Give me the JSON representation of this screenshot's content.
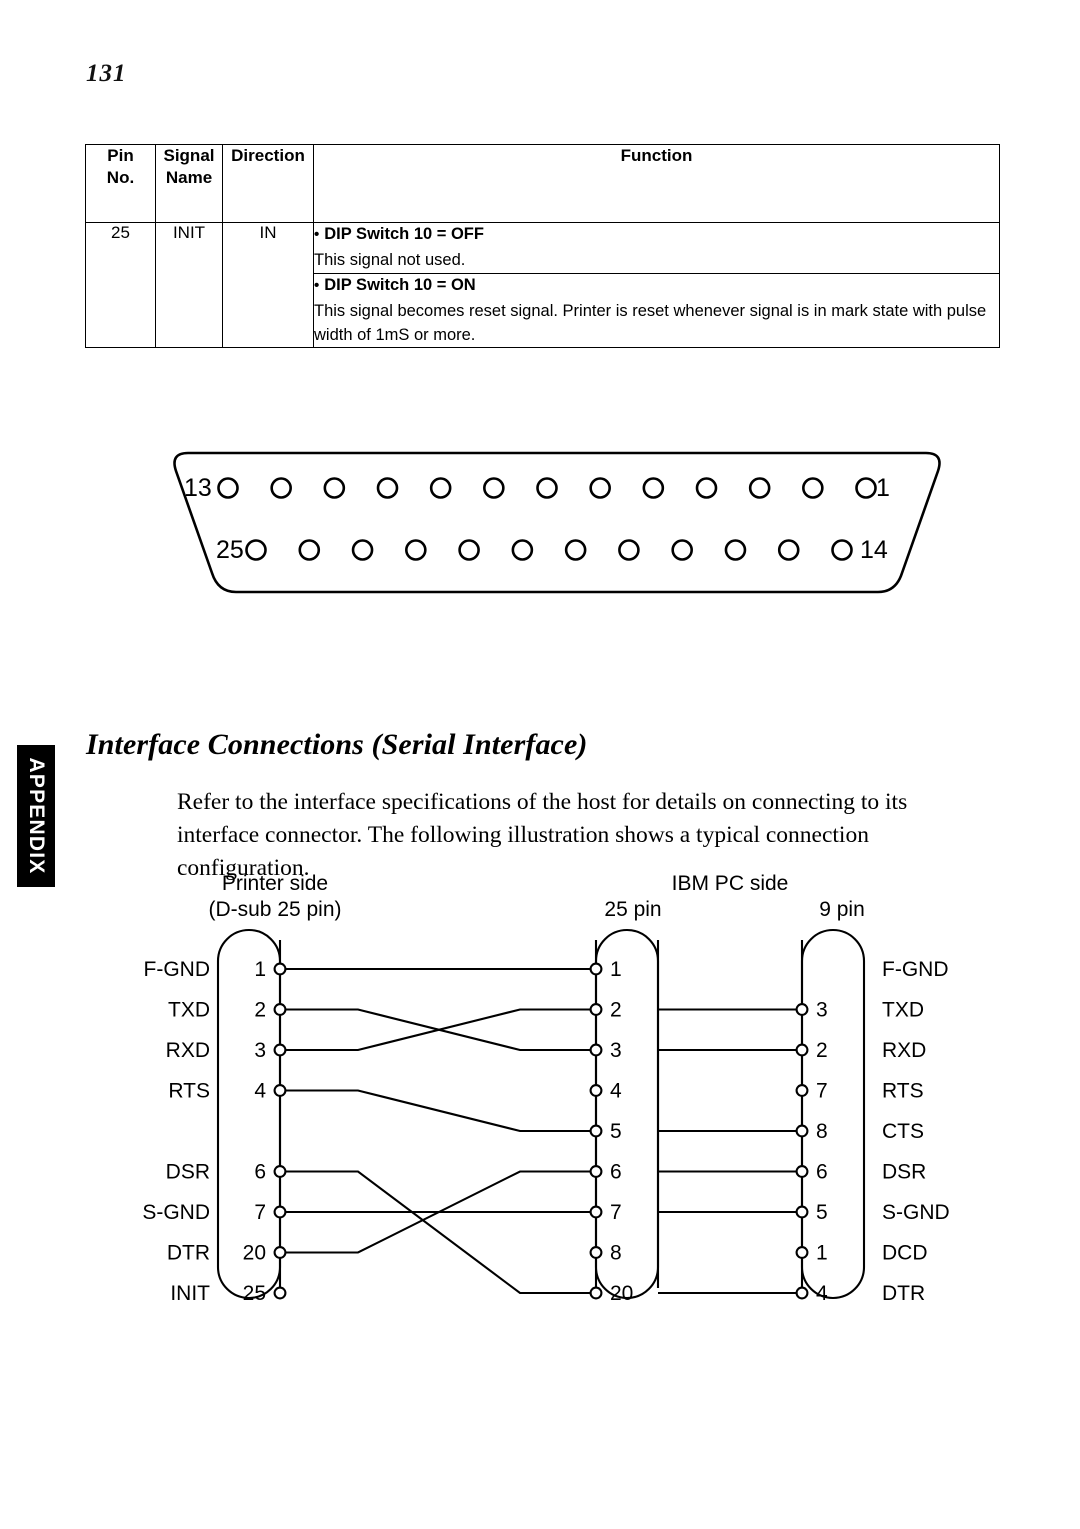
{
  "page": {
    "number": "131",
    "appendix_tab": "APPENDIX"
  },
  "pin_table": {
    "headers": {
      "pin_no": "Pin\nNo.",
      "pin_no_line1": "Pin",
      "pin_no_line2": "No.",
      "signal_name_line1": "Signal",
      "signal_name_line2": "Name",
      "direction": "Direction",
      "function": "Function"
    },
    "rows": [
      {
        "pin_no": "25",
        "signal_name": "INIT",
        "direction": "IN",
        "function_blocks": [
          {
            "bullet": "DIP Switch 10 = OFF",
            "body": "This signal not used."
          },
          {
            "bullet": "DIP Switch 10 = ON",
            "body": "This signal becomes reset signal. Printer is reset whenever signal is in mark state with pulse width of 1mS or more."
          }
        ]
      }
    ]
  },
  "dsub_connector": {
    "top_row_left_label": "13",
    "top_row_right_label": "1",
    "bottom_row_left_label": "25",
    "bottom_row_right_label": "14",
    "top_row_pin_count": 13,
    "bottom_row_pin_count": 12
  },
  "section": {
    "heading": "Interface Connections (Serial Interface)",
    "paragraph": "Refer to the interface specifications of the host for details on connecting to its interface connector. The following illustration shows a typical connection configuration."
  },
  "wiring_diagram": {
    "labels": {
      "printer_side_line1": "Printer side",
      "printer_side_line2": "(D-sub 25 pin)",
      "ibm_side": "IBM PC side",
      "ibm_25pin": "25 pin",
      "ibm_9pin": "9 pin"
    },
    "printer_pins": [
      {
        "signal": "F-GND",
        "pin": "1",
        "row": 0
      },
      {
        "signal": "TXD",
        "pin": "2",
        "row": 1
      },
      {
        "signal": "RXD",
        "pin": "3",
        "row": 2
      },
      {
        "signal": "RTS",
        "pin": "4",
        "row": 3
      },
      {
        "signal": "",
        "pin": "",
        "row": 4
      },
      {
        "signal": "DSR",
        "pin": "6",
        "row": 5
      },
      {
        "signal": "S-GND",
        "pin": "7",
        "row": 6
      },
      {
        "signal": "DTR",
        "pin": "20",
        "row": 7
      },
      {
        "signal": "INIT",
        "pin": "25",
        "row": 8
      }
    ],
    "ibm_25pin_pins": [
      {
        "pin": "1",
        "row": 0
      },
      {
        "pin": "2",
        "row": 1
      },
      {
        "pin": "3",
        "row": 2
      },
      {
        "pin": "4",
        "row": 3
      },
      {
        "pin": "5",
        "row": 4
      },
      {
        "pin": "6",
        "row": 5
      },
      {
        "pin": "7",
        "row": 6
      },
      {
        "pin": "8",
        "row": 7
      },
      {
        "pin": "20",
        "row": 8
      }
    ],
    "ibm_9pin_pins": [
      {
        "signal": "F-GND",
        "pin": "",
        "row": 0
      },
      {
        "signal": "TXD",
        "pin": "3",
        "row": 1
      },
      {
        "signal": "RXD",
        "pin": "2",
        "row": 2
      },
      {
        "signal": "RTS",
        "pin": "7",
        "row": 3
      },
      {
        "signal": "CTS",
        "pin": "8",
        "row": 4
      },
      {
        "signal": "DSR",
        "pin": "6",
        "row": 5
      },
      {
        "signal": "S-GND",
        "pin": "5",
        "row": 6
      },
      {
        "signal": "DCD",
        "pin": "1",
        "row": 7
      },
      {
        "signal": "DTR",
        "pin": "4",
        "row": 8
      }
    ],
    "connections_printer_to_25pin": [
      {
        "from_row": 0,
        "to_row": 0
      },
      {
        "from_row": 1,
        "to_row": 2
      },
      {
        "from_row": 2,
        "to_row": 1
      },
      {
        "from_row": 3,
        "to_row": 4
      },
      {
        "from_row": 5,
        "to_row": 8
      },
      {
        "from_row": 6,
        "to_row": 6
      },
      {
        "from_row": 7,
        "to_row": 5
      }
    ],
    "connections_25pin_to_9pin": [
      {
        "row": 1
      },
      {
        "row": 2
      },
      {
        "row": 4
      },
      {
        "row": 5
      },
      {
        "row": 6
      },
      {
        "row": 8
      }
    ]
  },
  "colors": {
    "ink": "#000000",
    "paper": "#ffffff",
    "tab_background": "#000000",
    "tab_text": "#ffffff"
  }
}
